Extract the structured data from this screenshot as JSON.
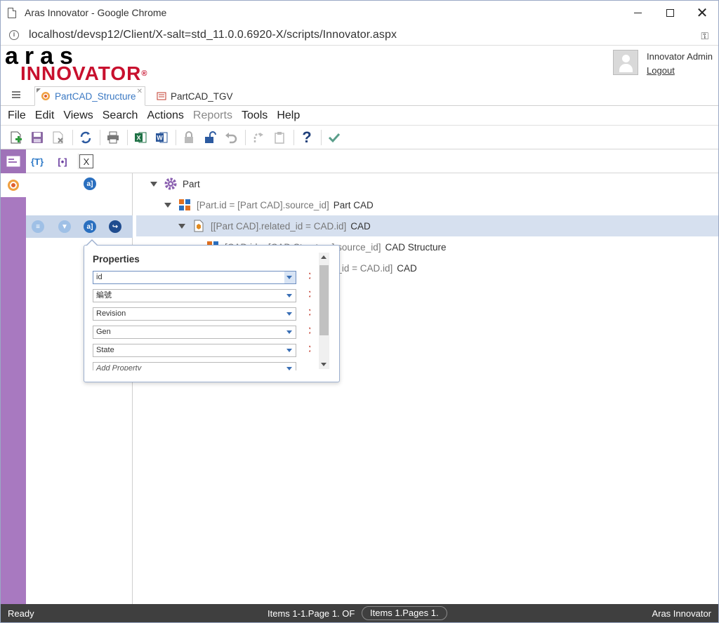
{
  "browser": {
    "title": "Aras Innovator - Google Chrome",
    "url": "localhost/devsp12/Client/X-salt=std_11.0.0.6920-X/scripts/Innovator.aspx"
  },
  "header": {
    "logo_top": "aras",
    "logo_bottom": "INNOVATOR",
    "logo_mark": "®",
    "user_name": "Innovator Admin",
    "logout_label": "Logout"
  },
  "tabs": [
    {
      "label": "PartCAD_Structure",
      "active": true
    },
    {
      "label": "PartCAD_TGV",
      "active": false
    }
  ],
  "menu": [
    {
      "label": "File",
      "disabled": false
    },
    {
      "label": "Edit",
      "disabled": false
    },
    {
      "label": "Views",
      "disabled": false
    },
    {
      "label": "Search",
      "disabled": false
    },
    {
      "label": "Actions",
      "disabled": false
    },
    {
      "label": "Reports",
      "disabled": true
    },
    {
      "label": "Tools",
      "disabled": false
    },
    {
      "label": "Help",
      "disabled": false
    }
  ],
  "toolbar2": {
    "btn1": "{T}",
    "btn2": "[•]",
    "btn3": "X"
  },
  "tree": {
    "row1": {
      "label": "Part"
    },
    "row2": {
      "condition": "[Part.id = [Part CAD].source_id]",
      "label": "Part CAD"
    },
    "row3": {
      "condition": "[[Part CAD].related_id = CAD.id]",
      "label": "CAD"
    },
    "row4": {
      "condition": "[CAD.id = [CAD Structure].source_id]",
      "label": "CAD Structure"
    },
    "row5": {
      "condition": "[[CAD Structure].related_id = CAD.id]",
      "label": "CAD"
    }
  },
  "popup": {
    "title": "Properties",
    "properties": [
      "id",
      "編號",
      "Revision",
      "Gen",
      "State"
    ],
    "add_placeholder": "Add Property"
  },
  "status": {
    "ready": "Ready",
    "items": "Items 1-1.Page 1. OF",
    "pages": "Items 1.Pages 1.",
    "brand": "Aras Innovator"
  },
  "colors": {
    "accent_purple": "#a879c0",
    "brand_red": "#c8102e",
    "selected_row": "#d6e0ef",
    "status_bar": "#3f3f3f",
    "delete_red": "#c0392b"
  }
}
